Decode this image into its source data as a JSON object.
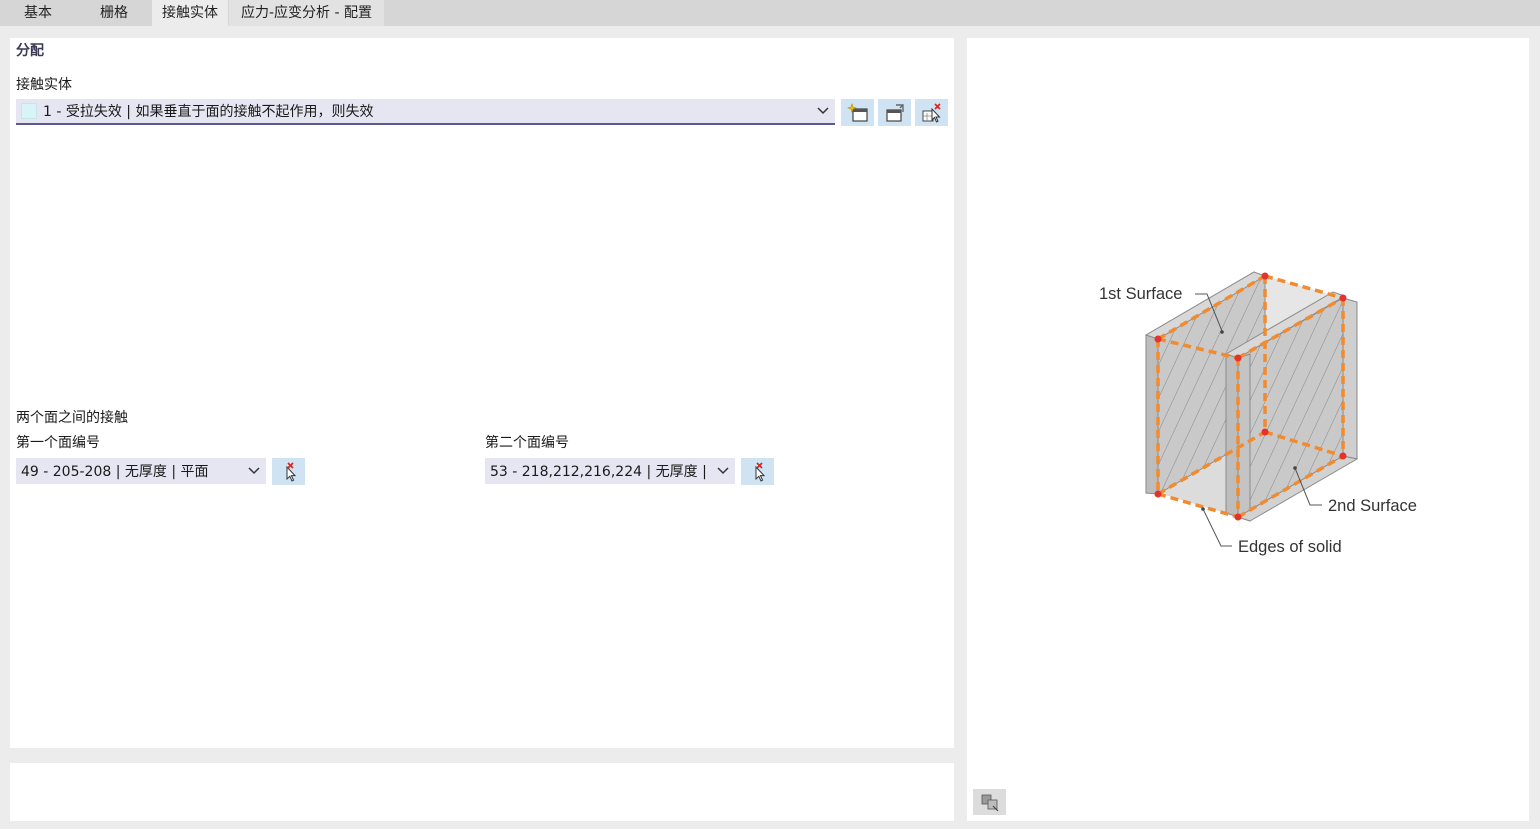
{
  "tabs": [
    {
      "label": "基本"
    },
    {
      "label": "栅格"
    },
    {
      "label": "接触实体"
    },
    {
      "label": "应力-应变分析 - 配置"
    }
  ],
  "assignment": {
    "section_title": "分配",
    "contact_solid_label": "接触实体",
    "contact_solid_value": "1 - 受拉失效 | 如果垂直于面的接触不起作用，则失效",
    "contact_between_label": "两个面之间的接触",
    "first_surface_label": "第一个面编号",
    "first_surface_value": "49 - 205-208 | 无厚度 | 平面",
    "second_surface_label": "第二个面编号",
    "second_surface_value": "53 - 218,212,216,224 | 无厚度 | ..."
  },
  "figure": {
    "label_1st": "1st Surface",
    "label_2nd": "2nd Surface",
    "label_edges": "Edges of solid"
  },
  "icons": {
    "new": "new-item-icon",
    "edit": "edit-item-icon",
    "select_delete": "pick-delete-icon",
    "pick": "pick-from-model-icon",
    "figure_toggle": "figure-options-icon"
  },
  "colors": {
    "combo_bg": "#e6e6f3",
    "button_bg": "#cfe3f3",
    "edge_orange": "#f28a2e",
    "node_red": "#e5322b"
  }
}
